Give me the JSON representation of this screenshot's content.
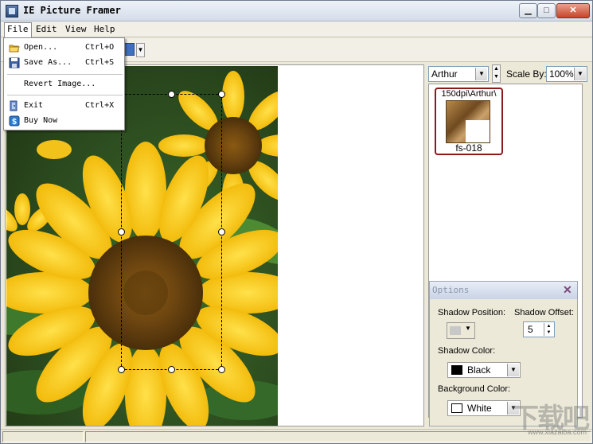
{
  "window": {
    "title": "IE Picture Framer"
  },
  "menu": {
    "items": [
      "File",
      "Edit",
      "View",
      "Help"
    ],
    "active": "File"
  },
  "file_menu": {
    "items": [
      {
        "label": "Open...",
        "shortcut": "Ctrl+O",
        "icon": "open-folder-icon"
      },
      {
        "label": "Save As...",
        "shortcut": "Ctrl+S",
        "icon": "floppy-disk-icon"
      },
      {
        "label": "Revert Image...",
        "shortcut": "",
        "icon": ""
      },
      {
        "label": "Exit",
        "shortcut": "Ctrl+X",
        "icon": "exit-door-icon"
      },
      {
        "label": "Buy Now",
        "shortcut": "",
        "icon": "buy-now-icon"
      }
    ]
  },
  "frame_panel": {
    "style_value": "Arthur",
    "scale_label": "Scale By:",
    "scale_value": "100%",
    "frames": [
      {
        "category": "150dpi\\Arthur\\",
        "name": "fs-018"
      }
    ]
  },
  "options": {
    "title": "Options",
    "shadow_position_label": "Shadow Position:",
    "shadow_offset_label": "Shadow Offset:",
    "shadow_offset_value": "5",
    "shadow_color_label": "Shadow Color:",
    "shadow_color_value": "Black",
    "background_color_label": "Background Color:",
    "background_color_value": "White"
  },
  "colors": {
    "accent": "#3f6fbf",
    "frame_border": "#8b1a1a",
    "close_button": "#c8442a"
  },
  "watermark": {
    "url": "www.xiazaiba.com"
  }
}
